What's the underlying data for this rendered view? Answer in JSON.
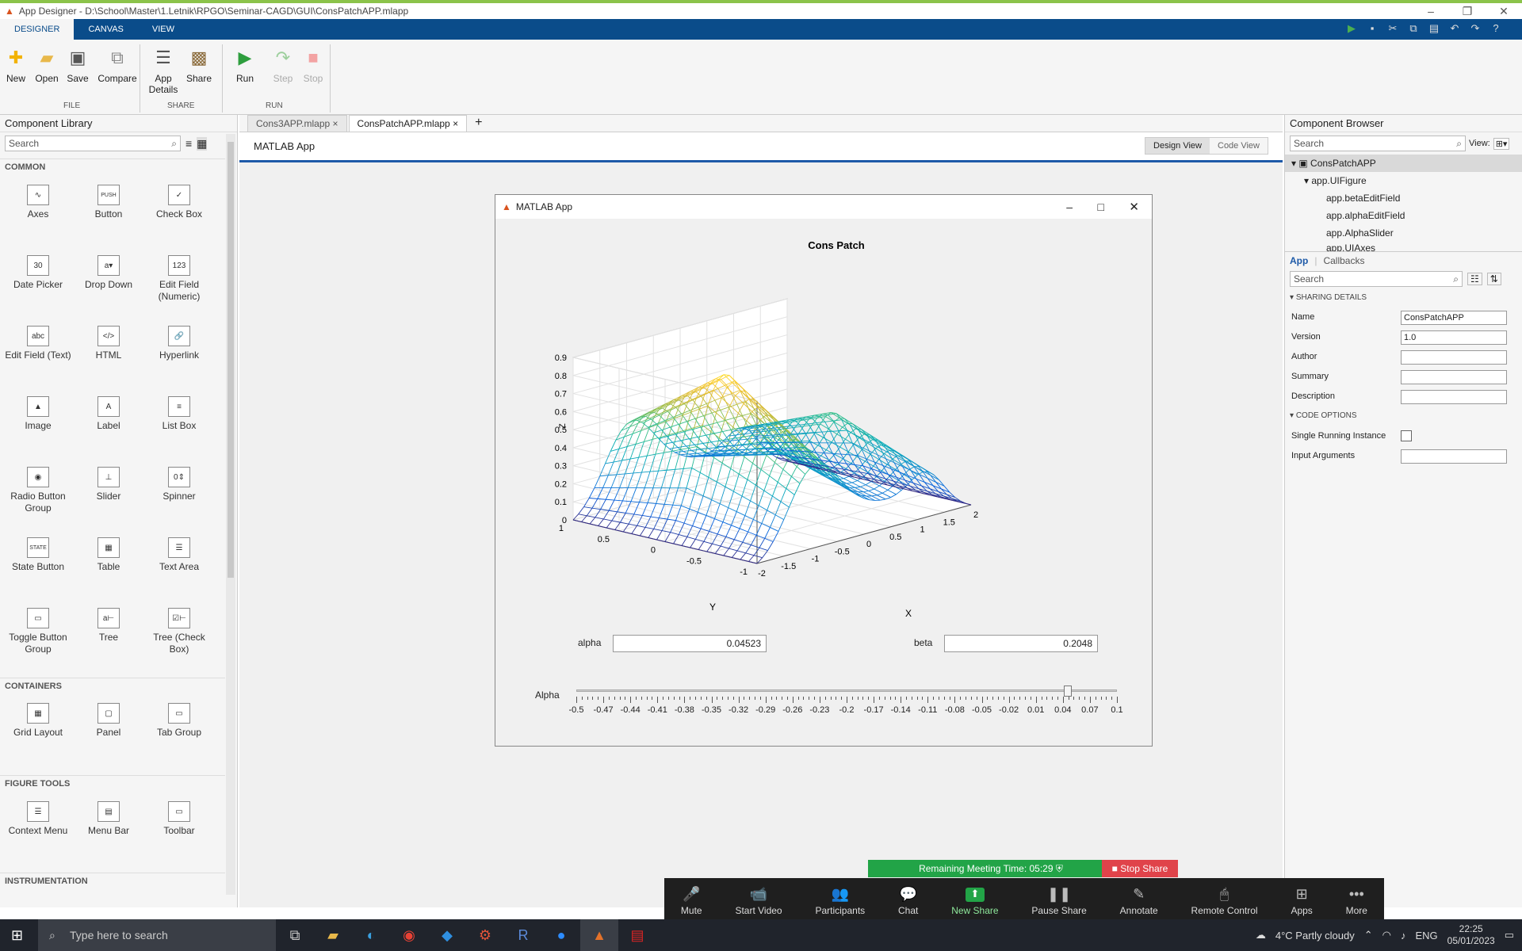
{
  "window": {
    "title": "App Designer - D:\\School\\Master\\1.Letnik\\RPGO\\Seminar-CAGD\\GUI\\ConsPatchAPP.mlapp"
  },
  "tabs": [
    "DESIGNER",
    "CANVAS",
    "VIEW"
  ],
  "ribbon": {
    "new": "New",
    "open": "Open",
    "save": "Save",
    "compare": "Compare",
    "app_details": "App Details",
    "share": "Share",
    "run": "Run",
    "step": "Step",
    "stop": "Stop",
    "groups": {
      "file": "FILE",
      "share": "SHARE",
      "run": "RUN"
    }
  },
  "library": {
    "title": "Component Library",
    "search": "Search",
    "sections": {
      "common": "COMMON",
      "containers": "CONTAINERS",
      "figure_tools": "FIGURE TOOLS",
      "instrumentation": "INSTRUMENTATION"
    },
    "common": [
      {
        "label": "Axes",
        "icon": "axes-icon",
        "glyph": "∿"
      },
      {
        "label": "Button",
        "icon": "button-icon",
        "glyph": "PUSH"
      },
      {
        "label": "Check Box",
        "icon": "checkbox-icon",
        "glyph": "✓"
      },
      {
        "label": "Date Picker",
        "icon": "date-picker-icon",
        "glyph": "30"
      },
      {
        "label": "Drop Down",
        "icon": "drop-down-icon",
        "glyph": "a▾"
      },
      {
        "label": "Edit Field (Numeric)",
        "icon": "edit-numeric-icon",
        "glyph": "123"
      },
      {
        "label": "Edit Field (Text)",
        "icon": "edit-text-icon",
        "glyph": "abc"
      },
      {
        "label": "HTML",
        "icon": "html-icon",
        "glyph": "</>"
      },
      {
        "label": "Hyperlink",
        "icon": "hyperlink-icon",
        "glyph": "🔗"
      },
      {
        "label": "Image",
        "icon": "image-icon",
        "glyph": "▲"
      },
      {
        "label": "Label",
        "icon": "label-icon",
        "glyph": "A"
      },
      {
        "label": "List Box",
        "icon": "list-box-icon",
        "glyph": "≡"
      },
      {
        "label": "Radio Button Group",
        "icon": "radio-group-icon",
        "glyph": "◉"
      },
      {
        "label": "Slider",
        "icon": "slider-icon",
        "glyph": "⊥"
      },
      {
        "label": "Spinner",
        "icon": "spinner-icon",
        "glyph": "0⇕"
      },
      {
        "label": "State Button",
        "icon": "state-button-icon",
        "glyph": "STATE"
      },
      {
        "label": "Table",
        "icon": "table-icon",
        "glyph": "▦"
      },
      {
        "label": "Text Area",
        "icon": "text-area-icon",
        "glyph": "☰"
      },
      {
        "label": "Toggle Button Group",
        "icon": "toggle-group-icon",
        "glyph": "▭"
      },
      {
        "label": "Tree",
        "icon": "tree-icon",
        "glyph": "a⊢"
      },
      {
        "label": "Tree (Check Box)",
        "icon": "tree-checkbox-icon",
        "glyph": "☑⊢"
      }
    ],
    "containers": [
      {
        "label": "Grid Layout",
        "icon": "grid-layout-icon",
        "glyph": "▦"
      },
      {
        "label": "Panel",
        "icon": "panel-icon",
        "glyph": "▢"
      },
      {
        "label": "Tab Group",
        "icon": "tab-group-icon",
        "glyph": "▭"
      }
    ],
    "figure_tools": [
      {
        "label": "Context Menu",
        "icon": "context-menu-icon",
        "glyph": "☰"
      },
      {
        "label": "Menu Bar",
        "icon": "menu-bar-icon",
        "glyph": "▤"
      },
      {
        "label": "Toolbar",
        "icon": "toolbar-icon",
        "glyph": "▭"
      }
    ]
  },
  "doc_tabs": [
    "Cons3APP.mlapp",
    "ConsPatchAPP.mlapp"
  ],
  "canvas": {
    "header": "MATLAB App",
    "design_view": "Design View",
    "code_view": "Code View"
  },
  "app": {
    "title": "MATLAB App",
    "alpha_label": "alpha",
    "alpha_value": "0.04523",
    "beta_label": "beta",
    "beta_value": "0.2048",
    "slider_label": "Alpha",
    "slider_ticks": [
      "-0.5",
      "-0.47",
      "-0.44",
      "-0.41",
      "-0.38",
      "-0.35",
      "-0.32",
      "-0.29",
      "-0.26",
      "-0.23",
      "-0.2",
      "-0.17",
      "-0.14",
      "-0.11",
      "-0.08",
      "-0.05",
      "-0.02",
      "0.01",
      "0.04",
      "0.07",
      "0.1"
    ],
    "slider_value": 0.04523
  },
  "chart_data": {
    "type": "surface",
    "title": "Cons Patch",
    "xlabel": "X",
    "ylabel": "Y",
    "zlabel": "Z",
    "z_ticks": [
      "0",
      "0.1",
      "0.2",
      "0.3",
      "0.4",
      "0.5",
      "0.6",
      "0.7",
      "0.8",
      "0.9"
    ],
    "x_ticks": [
      "-2",
      "-1.5",
      "-1",
      "-0.5",
      "0",
      "0.5",
      "1",
      "1.5",
      "2"
    ],
    "y_ticks": [
      "-1",
      "-0.5",
      "0",
      "0.5",
      "1"
    ],
    "xlim": [
      -2,
      2
    ],
    "ylim": [
      -1,
      1
    ],
    "zlim": [
      0,
      0.9
    ],
    "colormap": "parula"
  },
  "browser": {
    "title": "Component Browser",
    "search": "Search",
    "view_label": "View:",
    "tree": [
      "ConsPatchAPP",
      "app.UIFigure",
      "app.betaEditField",
      "app.alphaEditField",
      "app.AlphaSlider",
      "app.UIAxes"
    ],
    "tabs": {
      "app": "App",
      "callbacks": "Callbacks"
    },
    "search2": "Search",
    "sharing": "SHARING DETAILS",
    "props": [
      {
        "label": "Name",
        "value": "ConsPatchAPP"
      },
      {
        "label": "Version",
        "value": "1.0"
      },
      {
        "label": "Author",
        "value": ""
      },
      {
        "label": "Summary",
        "value": ""
      },
      {
        "label": "Description",
        "value": ""
      }
    ],
    "code_options": "CODE OPTIONS",
    "single_instance": "Single Running Instance",
    "input_args": "Input Arguments"
  },
  "zoom": {
    "remaining": "Remaining Meeting Time: 05:29",
    "stop_share": "Stop Share",
    "buttons": [
      {
        "label": "Mute",
        "icon": "microphone-icon",
        "glyph": "🎤"
      },
      {
        "label": "Start Video",
        "icon": "video-off-icon",
        "glyph": "📹"
      },
      {
        "label": "Participants",
        "icon": "participants-icon",
        "glyph": "👥"
      },
      {
        "label": "Chat",
        "icon": "chat-icon",
        "glyph": "💬"
      },
      {
        "label": "New Share",
        "icon": "share-icon",
        "glyph": "⬆"
      },
      {
        "label": "Pause Share",
        "icon": "pause-icon",
        "glyph": "❚❚"
      },
      {
        "label": "Annotate",
        "icon": "pen-icon",
        "glyph": "✎"
      },
      {
        "label": "Remote Control",
        "icon": "mouse-icon",
        "glyph": "🖱"
      },
      {
        "label": "Apps",
        "icon": "apps-icon",
        "glyph": "⊞"
      },
      {
        "label": "More",
        "icon": "more-icon",
        "glyph": "•••"
      }
    ]
  },
  "taskbar": {
    "search_placeholder": "Type here to search",
    "weather": "4°C  Partly cloudy",
    "lang": "ENG",
    "time": "22:25",
    "date": "05/01/2023"
  }
}
